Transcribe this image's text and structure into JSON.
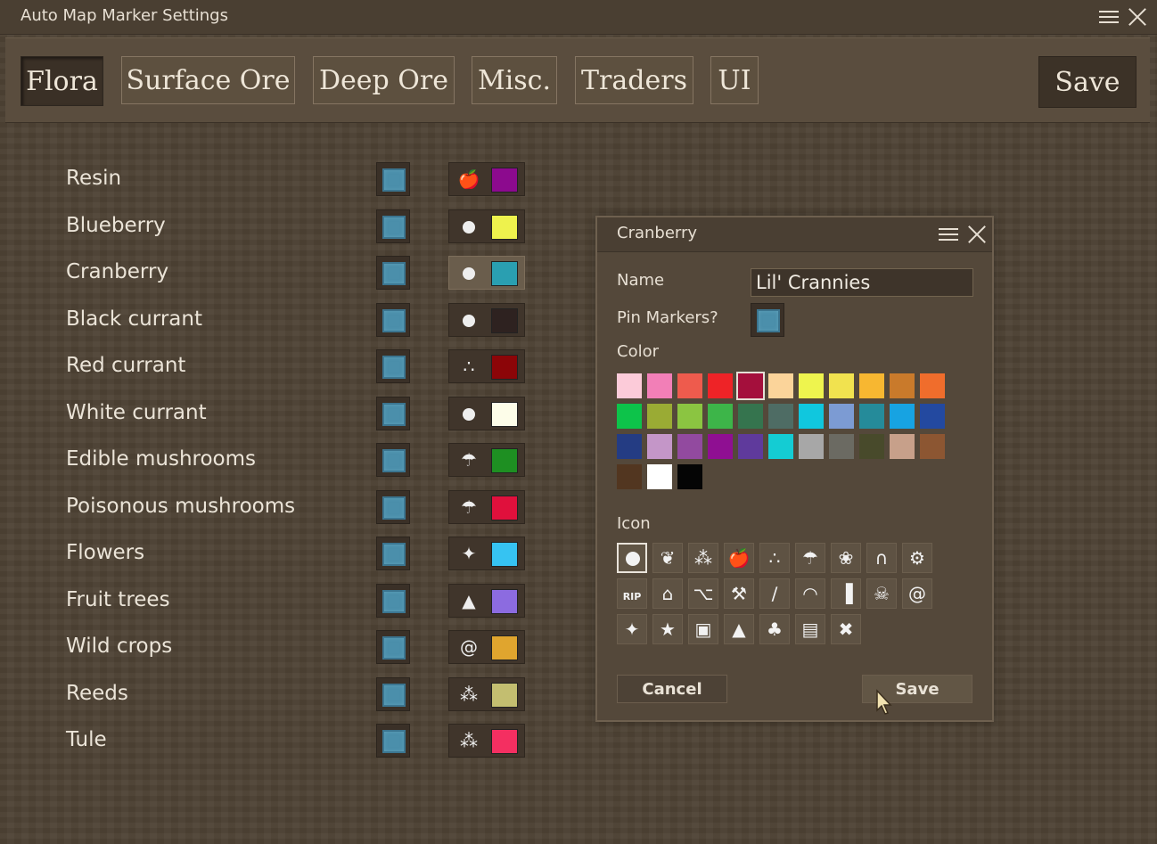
{
  "window": {
    "title": "Auto Map Marker Settings"
  },
  "tabs": [
    {
      "label": "Flora",
      "active": true
    },
    {
      "label": "Surface Ore",
      "active": false
    },
    {
      "label": "Deep Ore",
      "active": false
    },
    {
      "label": "Misc.",
      "active": false
    },
    {
      "label": "Traders",
      "active": false
    },
    {
      "label": "UI",
      "active": false
    }
  ],
  "save_label": "Save",
  "rows": [
    {
      "label": "Resin",
      "icon": "apple-icon",
      "color": "#8c0a8e"
    },
    {
      "label": "Blueberry",
      "icon": "circle-icon",
      "color": "#eef24d"
    },
    {
      "label": "Cranberry",
      "icon": "circle-icon",
      "color": "#2a9fb1"
    },
    {
      "label": "Black currant",
      "icon": "circle-icon",
      "color": "#2e2220"
    },
    {
      "label": "Red currant",
      "icon": "berries-icon",
      "color": "#8c0508"
    },
    {
      "label": "White currant",
      "icon": "circle-icon",
      "color": "#fdfde9"
    },
    {
      "label": "Edible mushrooms",
      "icon": "mushroom-icon",
      "color": "#1e8f22"
    },
    {
      "label": "Poisonous mushrooms",
      "icon": "mushroom-icon",
      "color": "#e0103c"
    },
    {
      "label": "Flowers",
      "icon": "star4-icon",
      "color": "#36c3f2"
    },
    {
      "label": "Fruit trees",
      "icon": "conifer-icon",
      "color": "#8c6be0"
    },
    {
      "label": "Wild crops",
      "icon": "spiral-icon",
      "color": "#e0a52e"
    },
    {
      "label": "Reeds",
      "icon": "wheat-icon",
      "color": "#c3be70"
    },
    {
      "label": "Tule",
      "icon": "wheat-icon",
      "color": "#f42f61"
    }
  ],
  "dialog": {
    "title": "Cranberry",
    "name_label": "Name",
    "name_value": "Lil' Crannies",
    "pin_label": "Pin Markers?",
    "color_label": "Color",
    "icon_label": "Icon",
    "cancel_label": "Cancel",
    "save_label": "Save",
    "colors": [
      "#fccbd9",
      "#f27fb7",
      "#ee5b4d",
      "#ee2327",
      "#a40f3c",
      "#fbd49a",
      "#eef44e",
      "#f1e24f",
      "#f7b731",
      "#c97a2b",
      "#f06d2c",
      "#0dc34a",
      "#9aab34",
      "#8bc541",
      "#3db549",
      "#35744e",
      "#4e6c64",
      "#10c7de",
      "#7c9bd3",
      "#258b9a",
      "#17a3e2",
      "#2349a0",
      "#243c83",
      "#c496c8",
      "#924a9f",
      "#8f0f92",
      "#5f3a9c",
      "#14ccd3",
      "#a7a7a7",
      "#6b6a62",
      "#484a2b",
      "#c7a08a",
      "#8c5632",
      "#523620",
      "#ffffff",
      "#050505"
    ],
    "selected_color": 4,
    "icons": [
      "circle-icon",
      "leaves-icon",
      "wheat-icon",
      "apple-icon",
      "berries-icon",
      "mushroom-icon",
      "bee-icon",
      "cave-icon",
      "gear-icon",
      "grave-icon",
      "house-icon",
      "anvil-icon",
      "pickaxe-icon",
      "scythe-icon",
      "rocks-icon",
      "bars-icon",
      "skull-icon",
      "spiral-icon",
      "star4-icon",
      "star5-icon",
      "wagon-icon",
      "conifer-icon",
      "tree-icon",
      "scroll-icon",
      "crossed-swords-icon"
    ],
    "selected_icon": 0
  }
}
